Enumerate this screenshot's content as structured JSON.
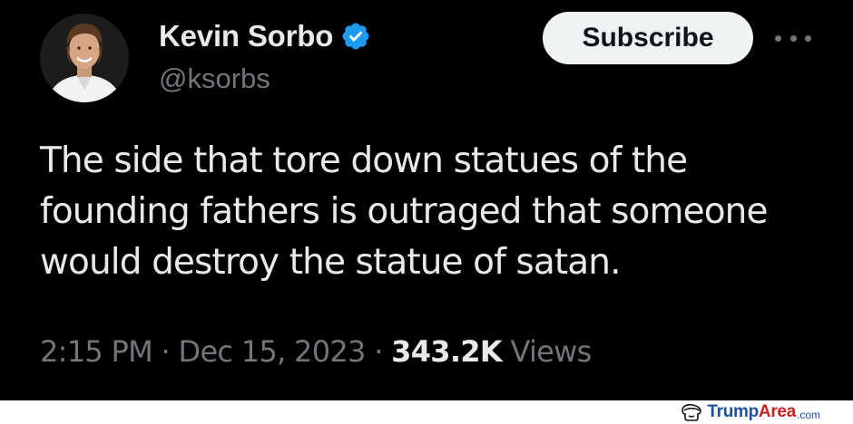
{
  "author": {
    "display_name": "Kevin Sorbo",
    "handle": "@ksorbs",
    "verified": true
  },
  "actions": {
    "subscribe_label": "Subscribe",
    "more_icon": "more-horizontal-icon"
  },
  "tweet": {
    "text": "The side that tore down statues of the founding fathers is outraged that someone would destroy the statue of satan.",
    "time": "2:15 PM",
    "separator": "·",
    "date": "Dec 15, 2023",
    "views_count": "343.2K",
    "views_label": "Views"
  },
  "watermark": {
    "brand_primary": "Trump",
    "brand_accent": "Area",
    "tld": ".com"
  },
  "colors": {
    "background": "#000000",
    "text_primary": "#e7e9ea",
    "text_secondary": "#71767b",
    "verified_blue": "#1d9bf0",
    "subscribe_bg": "#eff3f4"
  }
}
